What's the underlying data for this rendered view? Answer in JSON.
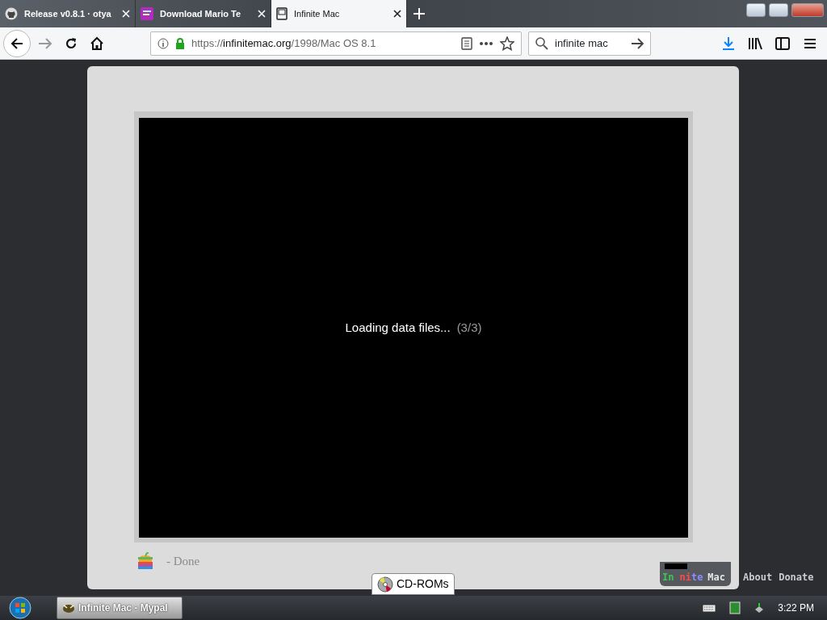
{
  "tabs": [
    {
      "title": "Release v0.8.1 · otya",
      "selected": false
    },
    {
      "title": "Download Mario Te",
      "selected": false
    },
    {
      "title": "Infinite Mac",
      "selected": true
    }
  ],
  "address": {
    "scheme": "https://",
    "host": "infinitemac.org",
    "path": "/1998/Mac OS 8.1"
  },
  "search": {
    "value": "infinite mac"
  },
  "screen": {
    "message": "Loading data files...",
    "progress": "(3/3)"
  },
  "bezel": {
    "status": "- Done"
  },
  "cdroms_button": "CD-ROMs",
  "logo": [
    {
      "text": "In",
      "color": "#3cc850"
    },
    {
      "text": "ni",
      "color": "#ff4a4a"
    },
    {
      "text": "te",
      "color": "#8c8cff"
    },
    {
      "text": "Mac",
      "color": "#e6e6e6"
    }
  ],
  "links": [
    "About",
    "Donate"
  ],
  "taskbar": {
    "window": "Infinite Mac - Mypal",
    "clock": "3:22 PM"
  }
}
